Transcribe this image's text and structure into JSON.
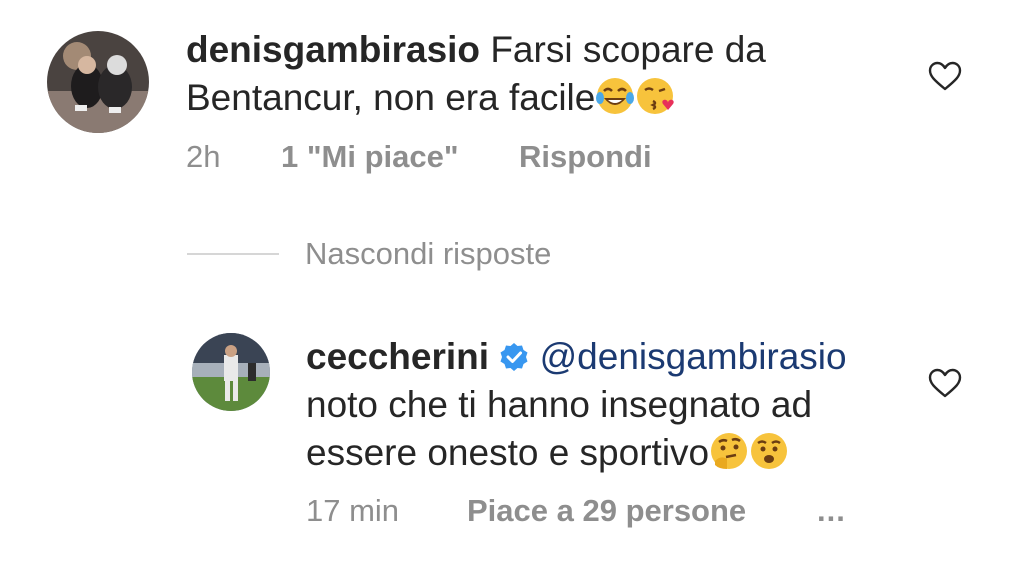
{
  "comment": {
    "username": "denisgambirasio",
    "text_line1": "Farsi scopare da",
    "text_line2": "Bentancur, non era facile",
    "emojis": [
      "joy-emoji",
      "kissing-heart-emoji"
    ],
    "time": "2h",
    "likes": "1 \"Mi piace\"",
    "reply_label": "Rispondi"
  },
  "replies_toggle": {
    "label": "Nascondi risposte"
  },
  "reply": {
    "username": "ceccherini",
    "verified": true,
    "mention": "@denisgambirasio",
    "text_line1": "noto che ti hanno insegnato ad",
    "text_line2": "essere onesto e sportivo",
    "emojis": [
      "thinking-face-emoji",
      "hushed-face-emoji"
    ],
    "time": "17 min",
    "likes": "Piace a 29 persone",
    "more": "..."
  },
  "colors": {
    "text": "#262626",
    "secondary": "#8e8e8e",
    "mention": "#1b3a72",
    "verified": "#3897f0"
  }
}
